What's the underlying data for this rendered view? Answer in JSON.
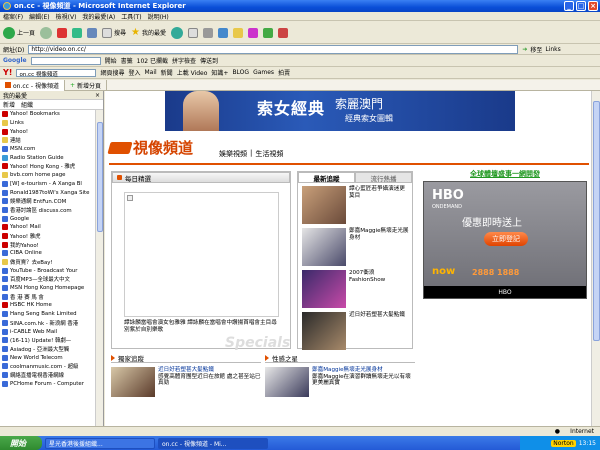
{
  "window": {
    "title": "on.cc - 視像頻道 - Microsoft Internet Explorer"
  },
  "menu": [
    "檔案(F)",
    "編輯(E)",
    "檢視(V)",
    "我的最愛(A)",
    "工具(T)",
    "說明(H)"
  ],
  "toolbar": {
    "back": "上一頁",
    "search": "搜尋",
    "favorites": "我的最愛"
  },
  "address": {
    "label": "網址(D)",
    "url": "http://video.on.cc/",
    "go": "移至",
    "links": "Links"
  },
  "google": {
    "label": "Google",
    "go": "開始",
    "bookmarks": "書籤",
    "blocked": "102 已攔截",
    "spell": "拼字檢查",
    "send": "傳送到"
  },
  "yahoo": {
    "label": "Y!",
    "search_value": "on.cc 視像頻道",
    "web_search": "網頁搜尋",
    "items": [
      "登入",
      "Mail",
      "新聞",
      "上載 Video",
      "知識+",
      "BLOG",
      "Games",
      "拍賣"
    ]
  },
  "tabs": [
    {
      "label": "on.cc - 視像頻道"
    },
    {
      "label": "新增分頁"
    }
  ],
  "sidebar": {
    "title": "我的最愛",
    "add": "新增",
    "organize": "組織",
    "items": [
      "Yahoo! Bookmarks",
      "Links",
      "Yahoo!",
      "連結",
      "MSN.com",
      "Radio Station Guide",
      "Yahoo! Hong Kong - 雅虎",
      "bvb.com home page",
      "[W] e-tourism - A Xanga Bl",
      "Ronald1987toWi's Xanga Site",
      "娛樂通網 EntFun.COM",
      "香港討論區 discuss.com",
      "Google",
      "Yahoo! Mail",
      "Yahoo! 雅虎",
      "我的Yahoo!",
      "CIBA Online",
      "做買賣？去eBay!",
      "YouTube - Broadcast Your",
      "百度MP3—全球最大中文",
      "MSN Hong Kong Homepage",
      "香 港 賽 馬 會",
      "HSBC HK Home",
      "Hang Seng Bank Limited",
      "SINA.com.hk - 新浪網 香港",
      "i-CABLE Web Mail",
      "(16-11) Update! 韓劇—",
      "Asiadog - 亞洲最大型觸",
      "New World Telecom",
      "coolmanmusic.com - 超級",
      "網絡直播電視香港網線",
      "PCHome Forum - Computer"
    ]
  },
  "page": {
    "banner": {
      "title": "索女經典",
      "sub": "索麗澳門",
      "sub2": "經典索女圖輯"
    },
    "logo": "視像頻道",
    "subnav": [
      "娛樂視頻",
      "|",
      "生活視頻"
    ],
    "daily": {
      "title": "每日精選",
      "caption": "譚詠麟當唱會演女包雅雅 譚詠麟在當唱會中讚揚首唱會主目尋 別紫於自別樂歌"
    },
    "latest": {
      "tabs": [
        "最新追蹤",
        "流行熱播"
      ],
      "items": [
        "譚心藍匠若爭攝演迷更莫目",
        "鄭嘉Maggie無壞走光展身材",
        "2007衝浪 FashionShow",
        "近日好若塑甚大髮點鐵"
      ]
    },
    "hbo": {
      "header": "全球體壇盛事一網開發",
      "brand": "HBO",
      "od": "ONDEMAND",
      "slogan": "優惠即時送上",
      "button": "立即登記",
      "now": "now",
      "phone": "2888 1888",
      "bottom": "HBO"
    },
    "hk": {
      "title": "獨家追蹤",
      "item_title": "近日好若塑甚大髮點鐵",
      "item_desc": "感覺高體育團型近日在旅館 處之甚至站已真勁"
    },
    "style": {
      "title": "性感之星",
      "item_title": "鄭嘉Maggie無壞走光展身材",
      "item_desc": "鄭嘉Maggie在演習群讀無壞走光以有壞更美麗真實"
    },
    "watermark": "Specials"
  },
  "status": {
    "text": "Internet"
  },
  "taskbar": {
    "start": "開始",
    "tasks": [
      "星光香港後援組織...",
      "on.cc - 視像頻道 - Mi..."
    ],
    "time": "13:15",
    "norton": "Norton"
  }
}
